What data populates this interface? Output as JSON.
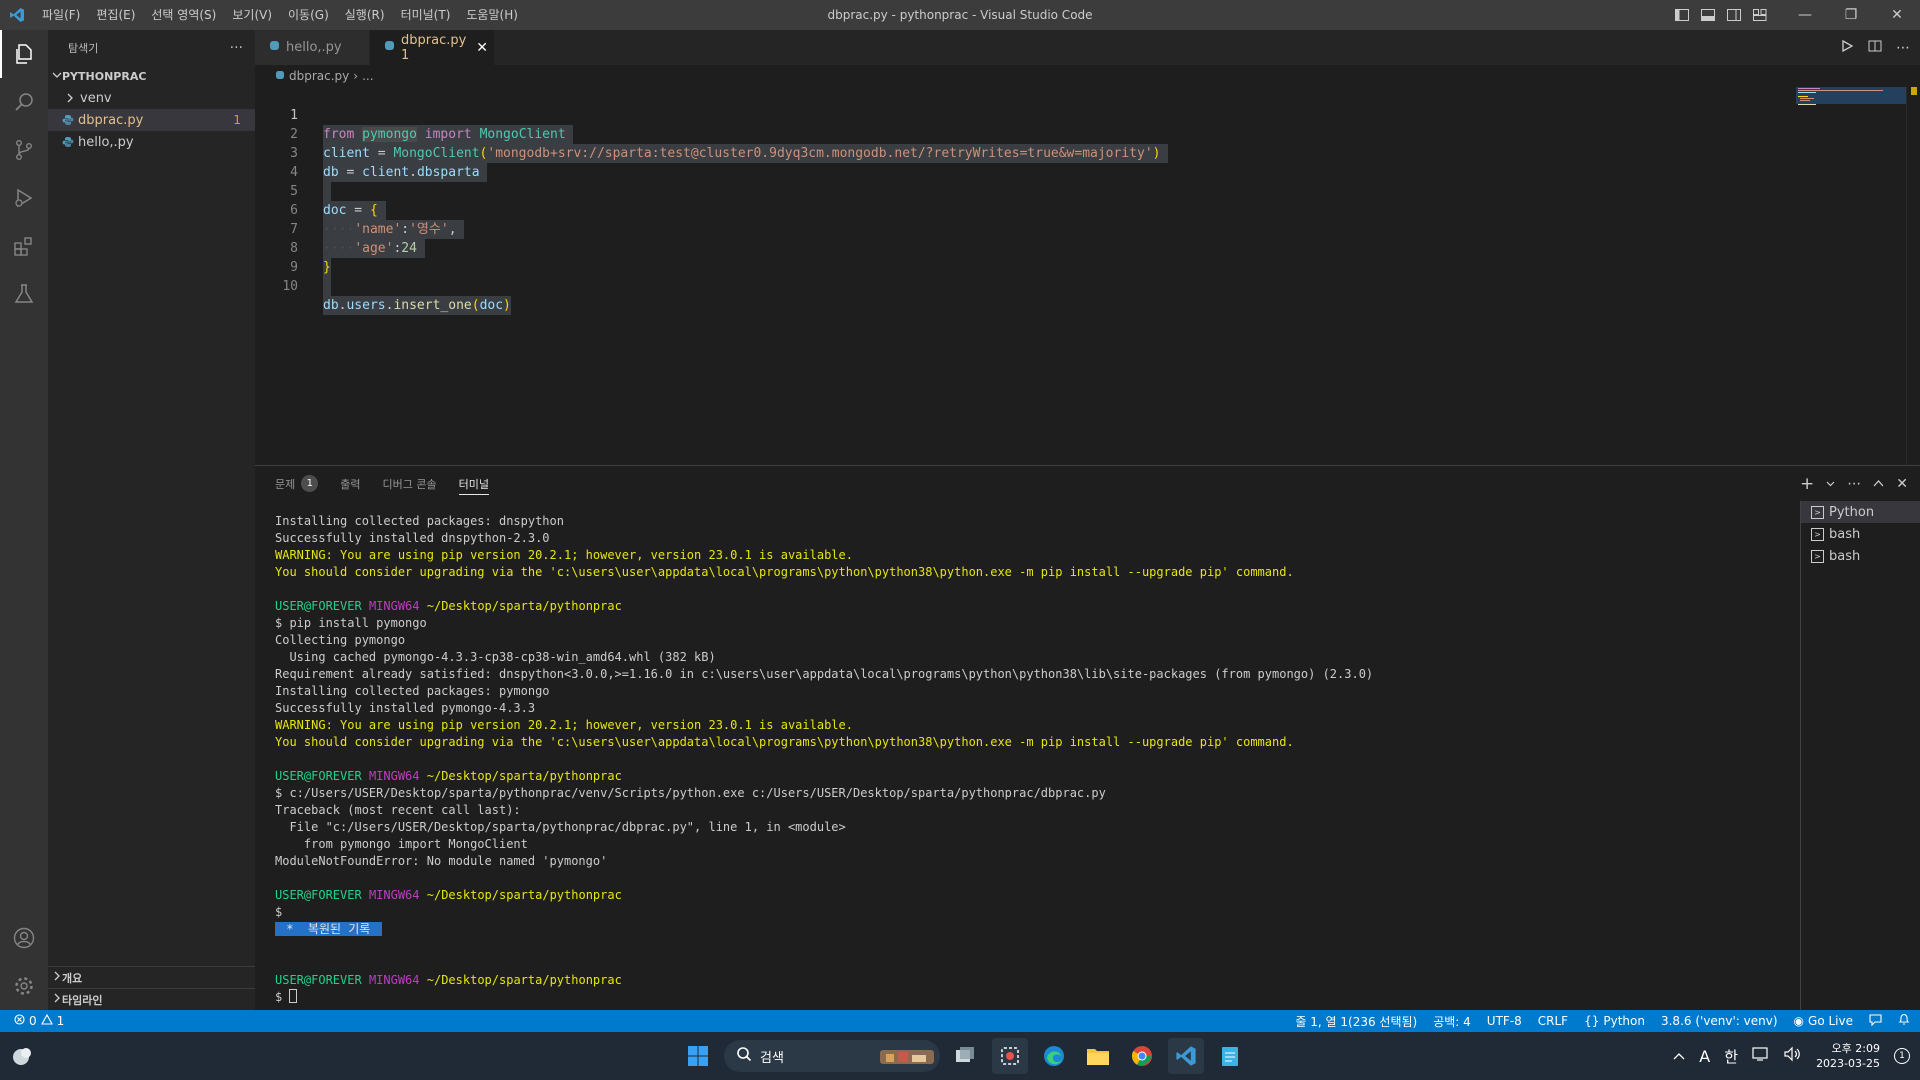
{
  "titlebar": {
    "menus": [
      "파일(F)",
      "편집(E)",
      "선택 영역(S)",
      "보기(V)",
      "이동(G)",
      "실행(R)",
      "터미널(T)",
      "도움말(H)"
    ],
    "title": "dbprac.py - pythonprac - Visual Studio Code"
  },
  "sidebar": {
    "header": "탐색기",
    "more": "···",
    "folder": "PYTHONPRAC",
    "items": [
      {
        "label": "venv",
        "type": "folder"
      },
      {
        "label": "dbprac.py",
        "type": "file",
        "badge": "1"
      },
      {
        "label": "hello,.py",
        "type": "file"
      }
    ],
    "outline": "개요",
    "timeline": "타임라인"
  },
  "tabs": [
    {
      "label": "hello,.py",
      "active": false
    },
    {
      "label": "dbprac.py 1",
      "active": true
    }
  ],
  "breadcrumb": {
    "file": "dbprac.py",
    "rest": "..."
  },
  "editor": {
    "line_numbers": [
      "1",
      "2",
      "3",
      "4",
      "5",
      "6",
      "7",
      "8",
      "9",
      "10"
    ],
    "l1": {
      "a": "from",
      "b": "pymongo",
      "c": "import",
      "d": "MongoClient"
    },
    "l2": {
      "a": "client",
      "b": " = ",
      "c": "MongoClient",
      "d": "(",
      "e": "'mongodb+srv://sparta:test@cluster0.9dyq3cm.mongodb.net/?retryWrites=true&w=majority'",
      "f": ")"
    },
    "l3": {
      "a": "db",
      "b": " = ",
      "c": "client",
      "d": ".",
      "e": "dbsparta"
    },
    "l5": {
      "a": "doc",
      "b": " = ",
      "c": "{"
    },
    "l6": {
      "ws": "····",
      "a": "'name'",
      "b": ":",
      "c": "'영수'",
      "d": ","
    },
    "l7": {
      "ws": "····",
      "a": "'age'",
      "b": ":",
      "c": "24"
    },
    "l8": {
      "a": "}"
    },
    "l10": {
      "a": "db",
      "b": ".",
      "c": "users",
      "d": ".",
      "e": "insert_one",
      "f": "(",
      "g": "doc",
      "h": ")"
    }
  },
  "panel": {
    "tabs": {
      "problems": "문제",
      "problems_count": "1",
      "output": "출력",
      "debug": "디버그 콘솔",
      "terminal": "터미널"
    },
    "terminal_lines": {
      "t1": "Installing collected packages: dnspython",
      "t2": "Successfully installed dnspython-2.3.0",
      "t3": "WARNING: You are using pip version 20.2.1; however, version 23.0.1 is available.",
      "t4": "You should consider upgrading via the 'c:\\users\\user\\appdata\\local\\programs\\python\\python38\\python.exe -m pip install --upgrade pip' command.",
      "p_user": "USER@FOREVER",
      "p_env": "MINGW64",
      "p_path": "~/Desktop/sparta/pythonprac",
      "t6": "$ pip install pymongo",
      "t7": "Collecting pymongo",
      "t8": "  Using cached pymongo-4.3.3-cp38-cp38-win_amd64.whl (382 kB)",
      "t9": "Requirement already satisfied: dnspython<3.0.0,>=1.16.0 in c:\\users\\user\\appdata\\local\\programs\\python\\python38\\lib\\site-packages (from pymongo) (2.3.0)",
      "t10": "Installing collected packages: pymongo",
      "t11": "Successfully installed pymongo-4.3.3",
      "t12": "WARNING: You are using pip version 20.2.1; however, version 23.0.1 is available.",
      "t13": "You should consider upgrading via the 'c:\\users\\user\\appdata\\local\\programs\\python\\python38\\python.exe -m pip install --upgrade pip' command.",
      "t15": "$ c:/Users/USER/Desktop/sparta/pythonprac/venv/Scripts/python.exe c:/Users/USER/Desktop/sparta/pythonprac/dbprac.py",
      "t16": "Traceback (most recent call last):",
      "t17": "  File \"c:/Users/USER/Desktop/sparta/pythonprac/dbprac.py\", line 1, in <module>",
      "t18": "    from pymongo import MongoClient",
      "t19": "ModuleNotFoundError: No module named 'pymongo'",
      "t21": "$",
      "restored": " *  복원된 기록 ",
      "t24": "$ "
    },
    "terminals": [
      "Python",
      "bash",
      "bash"
    ]
  },
  "statusbar": {
    "errors": "0",
    "warnings": "1",
    "position": "줄 1, 열 1(236 선택됨)",
    "spaces": "공백: 4",
    "encoding": "UTF-8",
    "eol": "CRLF",
    "language": "Python",
    "interpreter": "3.8.6 ('venv': venv)",
    "golive": "Go Live"
  },
  "taskbar": {
    "search": "검색",
    "ime_a": "A",
    "ime_han": "한",
    "time": "오후 2:09",
    "date": "2023-03-25",
    "notifications": "1"
  },
  "colors": {
    "accent": "#007acc",
    "warning": "#cca700"
  }
}
